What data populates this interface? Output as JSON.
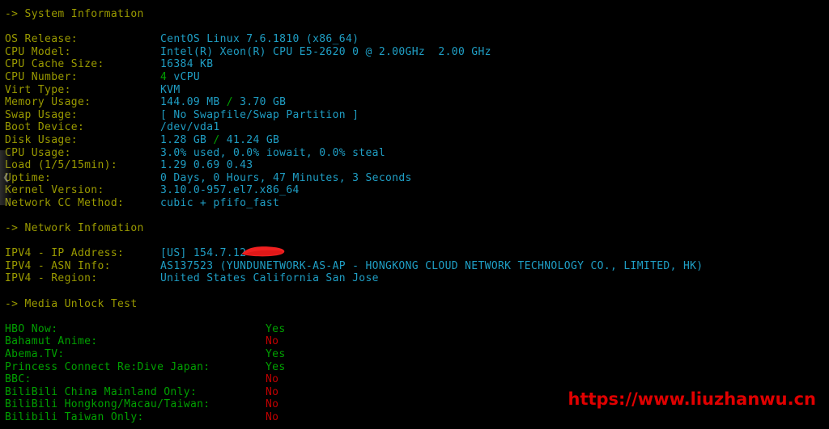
{
  "colors": {
    "background": "#000000",
    "section_header": "#9a9a00",
    "label": "#9a9a00",
    "value": "#1f9ec4",
    "green": "#00a000",
    "red": "#c00000",
    "watermark": "#e00000"
  },
  "sections": {
    "system": {
      "header": "-> System Information",
      "rows": [
        {
          "label": "OS Release:",
          "value": "CentOS Linux 7.6.1810 (x86_64)"
        },
        {
          "label": "CPU Model:",
          "value": "Intel(R) Xeon(R) CPU E5-2620 0 @ 2.00GHz  2.00 GHz"
        },
        {
          "label": "CPU Cache Size:",
          "value": "16384 KB"
        },
        {
          "label": "CPU Number:",
          "value_green": "4",
          "value": " vCPU"
        },
        {
          "label": "Virt Type:",
          "value": "KVM"
        },
        {
          "label": "Memory Usage:",
          "value": "144.09 MB",
          "sep": " / ",
          "value2": "3.70 GB"
        },
        {
          "label": "Swap Usage:",
          "value": "[ No Swapfile/Swap Partition ]"
        },
        {
          "label": "Boot Device:",
          "value": "/dev/vda1"
        },
        {
          "label": "Disk Usage:",
          "value": "1.28 GB",
          "sep": " / ",
          "value2": "41.24 GB"
        },
        {
          "label": "CPU Usage:",
          "value": "3.0% used, 0.0% iowait, 0.0% steal"
        },
        {
          "label": "Load (1/5/15min):",
          "value": "1.29 0.69 0.43"
        },
        {
          "label": "Uptime:",
          "value": "0 Days, 0 Hours, 47 Minutes, 3 Seconds"
        },
        {
          "label": "Kernel Version:",
          "value": "3.10.0-957.el7.x86_64"
        },
        {
          "label": "Network CC Method:",
          "value": "cubic + pfifo_fast"
        }
      ]
    },
    "network": {
      "header": "-> Network Infomation",
      "rows": [
        {
          "label": "IPV4 - IP Address:",
          "value": "[US] 154.7.12",
          "redacted": true
        },
        {
          "label": "IPV4 - ASN Info:",
          "value": "AS137523 (YUNDUNETWORK-AS-AP - HONGKONG CLOUD NETWORK TECHNOLOGY CO., LIMITED, HK)"
        },
        {
          "label": "IPV4 - Region:",
          "value": "United States California San Jose"
        }
      ]
    },
    "media": {
      "header": "-> Media Unlock Test",
      "rows": [
        {
          "label": "HBO Now:",
          "value": "Yes"
        },
        {
          "label": "Bahamut Anime:",
          "value": "No"
        },
        {
          "label": "Abema.TV:",
          "value": "Yes"
        },
        {
          "label": "Princess Connect Re:Dive Japan:",
          "value": "Yes"
        },
        {
          "label": "BBC:",
          "value": "No"
        },
        {
          "label": "BiliBili China Mainland Only:",
          "value": "No"
        },
        {
          "label": "BiliBili Hongkong/Macau/Taiwan:",
          "value": "No"
        },
        {
          "label": "Bilibili Taiwan Only:",
          "value": "No"
        }
      ]
    }
  },
  "watermark": "https://www.liuzhanwu.cn"
}
